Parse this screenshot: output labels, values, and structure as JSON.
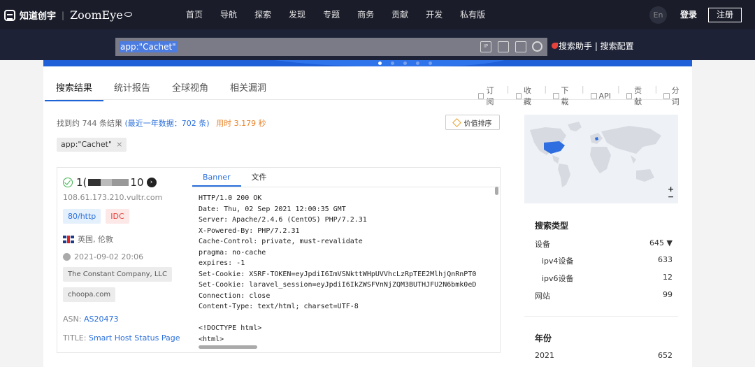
{
  "brand": {
    "cn": "知道创宇",
    "sep": "|",
    "en": "ZoomEye"
  },
  "nav": [
    "首页",
    "导航",
    "探索",
    "发现",
    "专题",
    "商务",
    "贡献",
    "开发",
    "私有版"
  ],
  "header": {
    "lang": "En",
    "login": "登录",
    "register": "注册"
  },
  "search": {
    "query": "app:\"Cachet\"",
    "helper": "搜索助手 | 搜索配置",
    "ip_icon_text": "IP"
  },
  "tabs": [
    "搜索结果",
    "统计报告",
    "全球视角",
    "相关漏洞"
  ],
  "actions": [
    {
      "icon": "bookmark-icon",
      "label": "订阅"
    },
    {
      "icon": "star-icon",
      "label": "收藏"
    },
    {
      "icon": "download-icon",
      "label": "下载"
    },
    {
      "icon": "link-icon",
      "label": "API"
    },
    {
      "icon": "edit-icon",
      "label": "贡献"
    },
    {
      "icon": "braces-icon",
      "label": "分词"
    }
  ],
  "results": {
    "count_prefix": "找到约 744 条结果",
    "recent": "(最近一年数据：702 条)",
    "time": "用时 3.179 秒",
    "sort_label": "价值排序",
    "filter_tag": "app:\"Cachet\"",
    "filter_close": "×"
  },
  "item": {
    "ip_prefix": "1(",
    "ip_suffix": "10",
    "arrow": "›",
    "hostname": "108.61.173.210.vultr.com",
    "port_badge": "80/http",
    "type_badge": "IDC",
    "location": "英国, 伦敦",
    "timestamp": "2021-09-02 20:06",
    "org1": "The Constant Company, LLC",
    "org2": "choopa.com",
    "asn_label": "ASN:",
    "asn_value": "AS20473",
    "title_label": "TITLE:",
    "title_value": "Smart Host Status Page",
    "banner_tabs": [
      "Banner",
      "文件"
    ],
    "banner_lines": [
      "HTTP/1.0 200 OK",
      "Date: Thu, 02 Sep 2021 12:00:35 GMT",
      "Server: Apache/2.4.6 (CentOS) PHP/7.2.31",
      "X-Powered-By: PHP/7.2.31",
      "Cache-Control: private, must-revalidate",
      "pragma: no-cache",
      "expires: -1",
      "Set-Cookie: XSRF-TOKEN=eyJpdiI6ImVSNkttWHpUVVhcLzRpTEE2MlhjQnRnPT0",
      "Set-Cookie: laravel_session=eyJpdiI6IkZWSFVnNjZQM3BUTHJFU2N6bmk0eD",
      "Connection: close",
      "Content-Type: text/html; charset=UTF-8",
      "",
      "<!DOCTYPE html>",
      "<html>"
    ]
  },
  "sidebar": {
    "map_zoom_in": "+",
    "map_zoom_out": "−",
    "type_title": "搜索类型",
    "type_rows": [
      {
        "label": "设备",
        "value": "645 ▼"
      },
      {
        "label": "ipv4设备",
        "value": "633"
      },
      {
        "label": "ipv6设备",
        "value": "12"
      },
      {
        "label": "网站",
        "value": "99"
      }
    ],
    "year_title": "年份",
    "year_rows": [
      {
        "label": "2021",
        "value": "652"
      }
    ]
  },
  "colors": {
    "accent": "#2a6fdb",
    "topbar": "#1a1c29",
    "map_highlight": "#2f6ee0"
  }
}
